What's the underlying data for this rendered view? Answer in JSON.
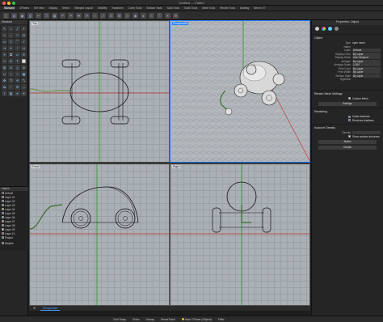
{
  "window": {
    "title": "Untitled — Edited"
  },
  "tabs": [
    "Standard",
    "CPlanes",
    "Set View",
    "Display",
    "Select",
    "Viewport Layout",
    "Visibility",
    "Transform",
    "Curve Tools",
    "Surface Tools",
    "Solid Tools",
    "SubD Tools",
    "Mesh Tools",
    "Render Tools",
    "Drafting",
    "New in V7"
  ],
  "active_tab": "Standard",
  "left_panel": {
    "section_standard": "Standard",
    "section_layers": "Layers",
    "layers": [
      {
        "name": "Default",
        "color": "#000000"
      },
      {
        "name": "Layer 01",
        "color": "#e04040"
      },
      {
        "name": "Layer 02",
        "color": "#4070e0"
      },
      {
        "name": "Layer 03",
        "color": "#40c040"
      },
      {
        "name": "Layer 04",
        "color": "#e0e040"
      },
      {
        "name": "Layer 05",
        "color": "#8040e0"
      },
      {
        "name": "Layer 06",
        "color": "#40e0e0"
      },
      {
        "name": "Layer 07",
        "color": "#e0a040"
      },
      {
        "name": "Layer 08",
        "color": "#808080"
      },
      {
        "name": "Layer 09",
        "color": "#ffffff"
      },
      {
        "name": "Layer 10",
        "color": "#c04080"
      },
      {
        "name": "Project",
        "color": "#40a080"
      }
    ],
    "disable_label": "Disable"
  },
  "viewports": {
    "top": "Top",
    "perspective": "Perspective",
    "front": "Front",
    "right": "Right"
  },
  "viewport_tabs": [
    "Perspective"
  ],
  "status": {
    "grid_snap": "Grid Snap",
    "ortho": "Ortho",
    "osnap": "Osnap",
    "smarttrack": "SmartTrack",
    "auto_cplane": "Auto CPlane (Object)",
    "filter": "Filter"
  },
  "properties": {
    "header": "Properties: Object",
    "object_section": "Object",
    "rows": [
      {
        "label": "Type",
        "value": "open mesh"
      },
      {
        "label": "Name",
        "value": ""
      },
      {
        "label": "Layer",
        "value": "Default"
      },
      {
        "label": "Display Color",
        "value": "By Layer"
      },
      {
        "label": "Display Mode",
        "value": "Use Viewport"
      },
      {
        "label": "Linetype",
        "value": "By Layer"
      },
      {
        "label": "Linetype Scale",
        "value": "1.000"
      },
      {
        "label": "Print Color",
        "value": "By Layer"
      },
      {
        "label": "Print Width",
        "value": "By Layer"
      },
      {
        "label": "Section Style",
        "value": "By Layer"
      },
      {
        "label": "Hyperlink",
        "value": ""
      }
    ],
    "render_mesh_section": "Render Mesh Settings",
    "custom_mesh": "Custom Mesh",
    "settings_btn": "Settings",
    "rendering_section": "Rendering",
    "casts_shadows": "Casts shadows",
    "receives_shadows": "Receives shadows",
    "isocurve_section": "Isocurve Density",
    "density_label": "Density",
    "show_surface_isocurves": "Show surface isocurves",
    "match_btn": "Match",
    "details_btn": "Details"
  }
}
